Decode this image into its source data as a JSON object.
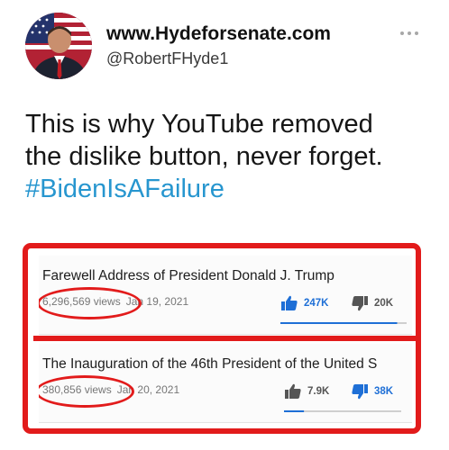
{
  "header": {
    "display_name": "www.Hydeforsenate.com",
    "handle": "@RobertFHyde1",
    "more_icon": "more-horizontal-icon"
  },
  "tweet": {
    "line1": "This is why YouTube removed",
    "line2": "the dislike button, never forget.",
    "hashtag": "#BidenIsAFailure"
  },
  "videos": [
    {
      "title": "Farewell Address of President Donald J. Trump",
      "views": "6,296,569 views",
      "date": "Jan 19, 2021",
      "likes": "247K",
      "dislikes": "20K",
      "liked_active": true,
      "disliked_active": false,
      "like_ratio": 0.925
    },
    {
      "title": "The Inauguration of the 46th President of the United S",
      "views": "380,856 views",
      "date": "Jan 20, 2021",
      "likes": "7.9K",
      "dislikes": "38K",
      "liked_active": false,
      "disliked_active": true,
      "like_ratio": 0.17
    }
  ],
  "colors": {
    "highlight_red": "#e21b1b",
    "youtube_blue": "#1e6fd6",
    "hashtag_blue": "#2796cf"
  }
}
